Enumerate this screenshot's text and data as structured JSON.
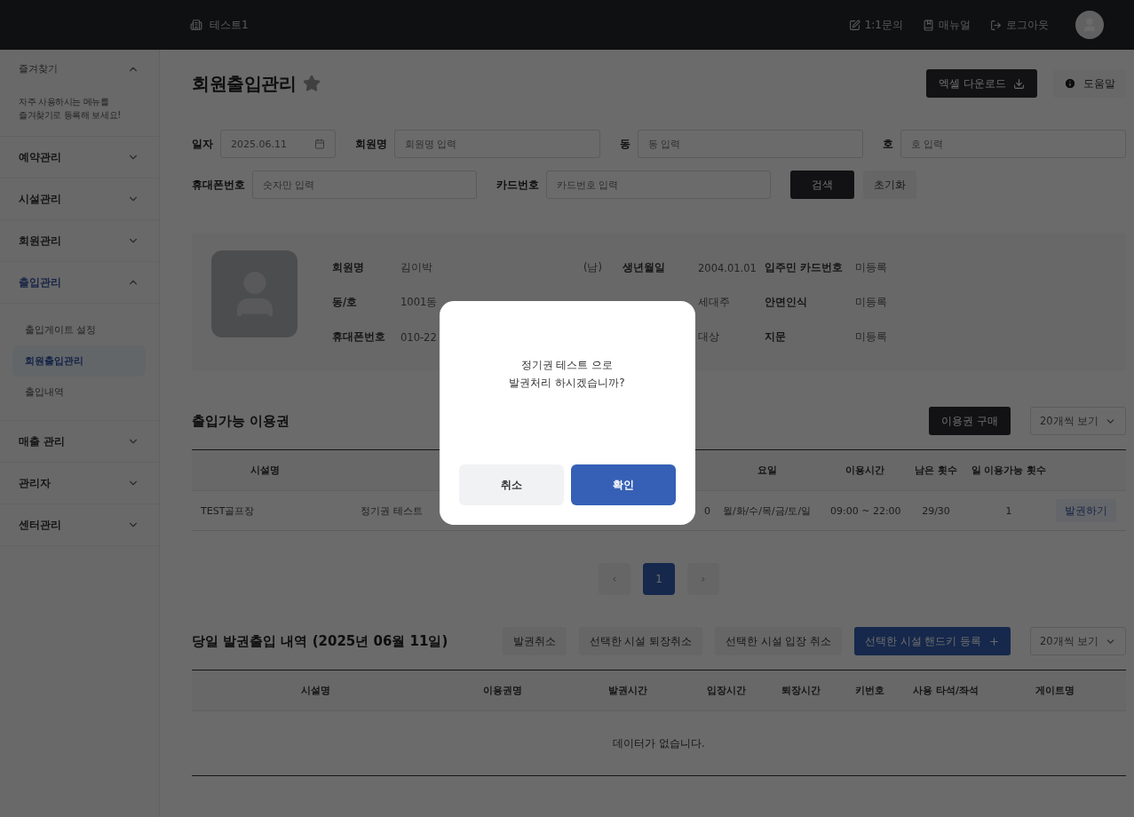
{
  "topbar": {
    "brand": "테스트1",
    "links": [
      {
        "kind": "inquiry",
        "label": "1:1문의"
      },
      {
        "kind": "manual",
        "label": "매뉴얼"
      },
      {
        "kind": "logout",
        "label": "로그아웃"
      }
    ]
  },
  "sidebar": {
    "favorites": {
      "title": "즐겨찾기",
      "expanded": true,
      "hint": "자주 사용하시는 메뉴를\n즐겨찾기로 등록해 보세요!"
    },
    "items": [
      {
        "label": "예약관리",
        "expanded": false
      },
      {
        "label": "시설관리",
        "expanded": false
      },
      {
        "label": "회원관리",
        "expanded": false
      },
      {
        "label": "출입관리",
        "expanded": true,
        "children": [
          {
            "label": "출입게이트 설정",
            "selected": false
          },
          {
            "label": "회원출입관리",
            "selected": true
          },
          {
            "label": "출입내역",
            "selected": false
          }
        ]
      },
      {
        "label": "매출 관리",
        "expanded": false
      },
      {
        "label": "관리자",
        "expanded": false
      },
      {
        "label": "센터관리",
        "expanded": false
      }
    ]
  },
  "page": {
    "title": "회원출입관리",
    "starred": false,
    "actions": [
      {
        "kind": "excel",
        "label": "엑셀 다운로드"
      },
      {
        "kind": "help",
        "label": "도움말"
      }
    ]
  },
  "filters": {
    "rows": [
      [
        {
          "kind": "date",
          "label": "일자",
          "value": "2025.06.11"
        },
        {
          "kind": "text",
          "label": "회원명",
          "placeholder": "회원명 입력"
        },
        {
          "kind": "text",
          "label": "동",
          "placeholder": "동 입력"
        },
        {
          "kind": "text",
          "label": "호",
          "placeholder": "호 입력"
        }
      ],
      [
        {
          "kind": "text",
          "label": "휴대폰번호",
          "placeholder": "숫자만 입력"
        },
        {
          "kind": "text",
          "label": "카드번호",
          "placeholder": "카드번호 입력"
        }
      ]
    ],
    "buttons": [
      {
        "kind": "primary",
        "label": "검색"
      },
      {
        "kind": "secondary",
        "label": "초기화"
      }
    ]
  },
  "profile": {
    "rows": [
      {
        "label_1": "회원명",
        "value_1": "김이박",
        "gender": "(남)",
        "label_2": "생년월일",
        "value_2": "2004.01.01",
        "label_3": "입주민 카드번호",
        "value_3": "미등록"
      },
      {
        "label_1": "동/호",
        "value_1": "1001동",
        "value_2": "세대주",
        "label_3": "안면인식",
        "value_3": "미등록"
      },
      {
        "label_1": "휴대폰번호",
        "value_1": "010-22",
        "value_2": "대상",
        "label_3": "지문",
        "value_3": "미등록"
      }
    ]
  },
  "passes": {
    "title": "출입가능 이용권",
    "buy_button": "이용권 구매",
    "page_size": "20개씩 보기",
    "columns": [
      {
        "label": "시설명"
      },
      {},
      {},
      {},
      {
        "label": "요일"
      },
      {
        "label": "이용시간"
      },
      {
        "label": "남은 횟수"
      },
      {
        "label": "일 이용가능 횟수"
      },
      {}
    ],
    "rows": [
      {
        "cells": [
          "TEST골프장",
          "정기권 테스트",
          null,
          "0",
          "월/화/수/목/금/토/일",
          "09:00 ~ 22:00",
          "29/30",
          "1"
        ],
        "action": "발권하기"
      }
    ],
    "pagination": {
      "prev": "‹",
      "next": "›",
      "pages": [
        {
          "label": "1",
          "selected": true
        }
      ]
    }
  },
  "history": {
    "title": "당일 발권출입 내역 (2025년 06월 11일)",
    "buttons": [
      {
        "kind": "light",
        "label": "발권취소"
      },
      {
        "kind": "light",
        "label": "선택한 시설 퇴장취소"
      },
      {
        "kind": "light",
        "label": "선택한 시설 입장 취소"
      },
      {
        "kind": "blue",
        "label": "선택한 시설 핸드키 등록"
      }
    ],
    "page_size": "20개씩 보기",
    "columns": [
      "시설명",
      "이용권명",
      "발권시간",
      "입장시간",
      "퇴장시간",
      "키번호",
      "사용 타석/좌석",
      "게이트명"
    ],
    "empty": "데이터가 없습니다."
  },
  "dialog": {
    "message": "정기권 테스트 으로\n발권처리 하시겠습니까?",
    "buttons": [
      {
        "kind": "cancel",
        "label": "취소"
      },
      {
        "kind": "confirm",
        "label": "확인"
      }
    ]
  }
}
